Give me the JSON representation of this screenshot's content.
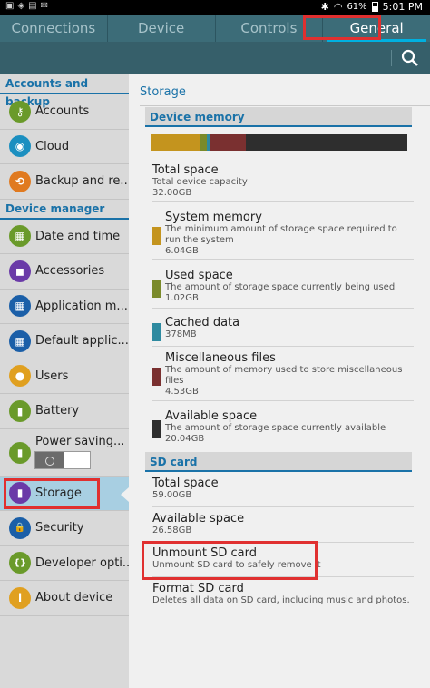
{
  "status_bar": {
    "battery": "61%",
    "time": "5:01 PM"
  },
  "tabs": [
    {
      "label": "Connections"
    },
    {
      "label": "Device"
    },
    {
      "label": "Controls"
    },
    {
      "label": "General"
    }
  ],
  "sidebar": {
    "sections": [
      {
        "title": "Accounts and backup"
      },
      {
        "title": "Device manager"
      }
    ],
    "items": [
      {
        "label": "Accounts",
        "color": "#6a9a2a",
        "glyph": "⚷"
      },
      {
        "label": "Cloud",
        "color": "#1b8fc0",
        "glyph": "◉"
      },
      {
        "label": "Backup and re...",
        "color": "#e07a20",
        "glyph": "⟲"
      },
      {
        "label": "Date and time",
        "color": "#6a9a2a",
        "glyph": "▦"
      },
      {
        "label": "Accessories",
        "color": "#6a3aa8",
        "glyph": "◼"
      },
      {
        "label": "Application m...",
        "color": "#1b5fa8",
        "glyph": "▦"
      },
      {
        "label": "Default applic...",
        "color": "#1b5fa8",
        "glyph": "▦"
      },
      {
        "label": "Users",
        "color": "#e0a020",
        "glyph": "●"
      },
      {
        "label": "Battery",
        "color": "#6a9a2a",
        "glyph": "▮"
      },
      {
        "label": "Power saving...",
        "color": "#6a9a2a",
        "glyph": "▮"
      },
      {
        "label": "Storage",
        "color": "#6a3aa8",
        "glyph": "▮"
      },
      {
        "label": "Security",
        "color": "#1b5fa8",
        "glyph": "🔒"
      },
      {
        "label": "Developer opti...",
        "color": "#6a9a2a",
        "glyph": "{}"
      },
      {
        "label": "About device",
        "color": "#e0a020",
        "glyph": "i"
      }
    ]
  },
  "main": {
    "title": "Storage",
    "device_memory": {
      "header": "Device memory",
      "bar": [
        {
          "name": "System memory",
          "color": "#c4941e",
          "fraction": 0.19
        },
        {
          "name": "Used space",
          "color": "#7a8a2a",
          "fraction": 0.03
        },
        {
          "name": "Cached data",
          "color": "#2e8aa0",
          "fraction": 0.012
        },
        {
          "name": "Misc",
          "color": "#7a3030",
          "fraction": 0.14
        },
        {
          "name": "Available space",
          "color": "#2e2e2e",
          "fraction": 0.628
        }
      ],
      "rows": [
        {
          "title": "Total space",
          "desc": "Total device capacity",
          "value": "32.00GB",
          "swatch": ""
        },
        {
          "title": "System memory",
          "desc": "The minimum amount of storage space required to run the system",
          "value": "6.04GB",
          "swatch": "#c4941e"
        },
        {
          "title": "Used space",
          "desc": "The amount of storage space currently being used",
          "value": "1.02GB",
          "swatch": "#7a8a2a"
        },
        {
          "title": "Cached data",
          "desc": "",
          "value": "378MB",
          "swatch": "#2e8aa0"
        },
        {
          "title": "Miscellaneous files",
          "desc": "The amount of memory used to store miscellaneous files",
          "value": "4.53GB",
          "swatch": "#7a3030"
        },
        {
          "title": "Available space",
          "desc": "The amount of storage space currently available",
          "value": "20.04GB",
          "swatch": "#2e2e2e"
        }
      ]
    },
    "sd_card": {
      "header": "SD card",
      "rows": [
        {
          "title": "Total space",
          "value": "59.00GB"
        },
        {
          "title": "Available space",
          "value": "26.58GB"
        },
        {
          "title": "Unmount SD card",
          "desc": "Unmount SD card to safely remove it"
        },
        {
          "title": "Format SD card",
          "desc": "Deletes all data on SD card, including music and photos."
        }
      ]
    }
  }
}
